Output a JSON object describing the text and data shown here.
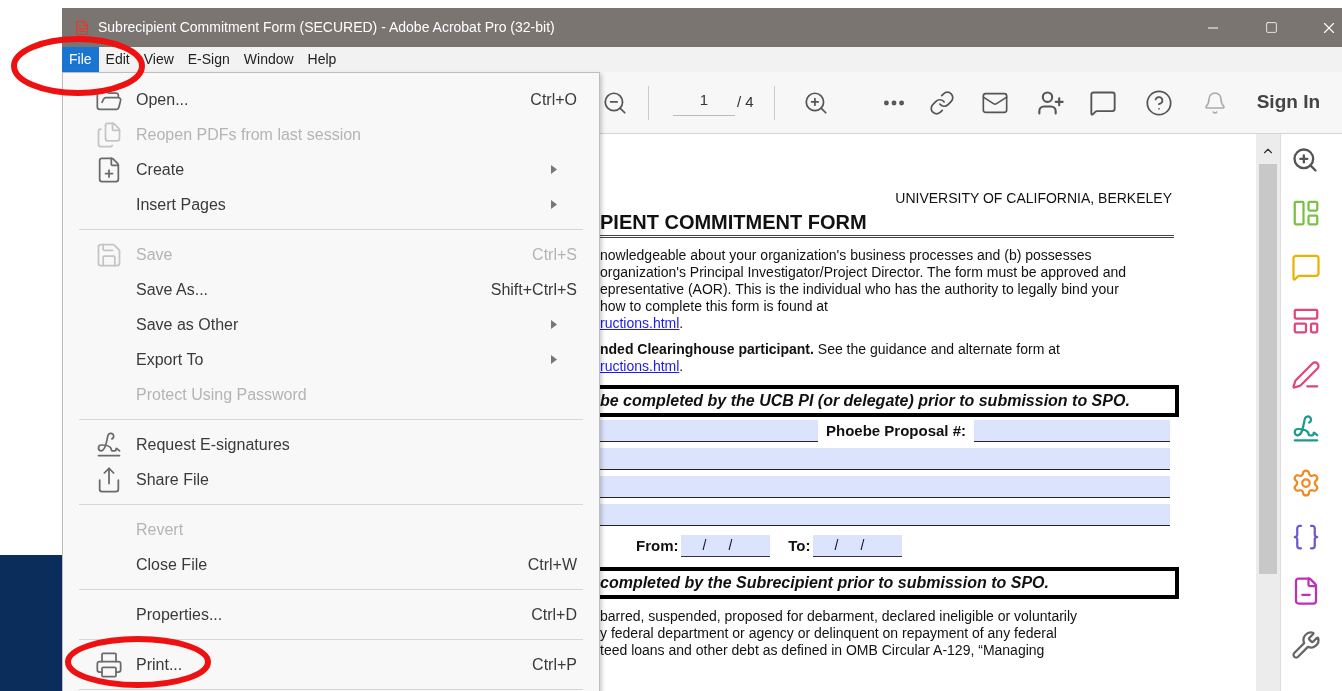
{
  "window": {
    "title": "Subrecipient Commitment Form (SECURED) - Adobe Acrobat Pro (32-bit)"
  },
  "menu_bar": [
    {
      "label": "File",
      "selected": true
    },
    {
      "label": "Edit",
      "selected": false
    },
    {
      "label": "View",
      "selected": false
    },
    {
      "label": "E-Sign",
      "selected": false
    },
    {
      "label": "Window",
      "selected": false
    },
    {
      "label": "Help",
      "selected": false
    }
  ],
  "file_menu": [
    {
      "kind": "item",
      "label": "Open...",
      "shortcut": "Ctrl+O",
      "disabled": false,
      "submenu": false
    },
    {
      "kind": "item",
      "label": "Reopen PDFs from last session",
      "disabled": true,
      "submenu": false
    },
    {
      "kind": "item",
      "label": "Create",
      "disabled": false,
      "submenu": true
    },
    {
      "kind": "item",
      "label": "Insert Pages",
      "disabled": false,
      "submenu": true
    },
    {
      "kind": "separator"
    },
    {
      "kind": "item",
      "label": "Save",
      "shortcut": "Ctrl+S",
      "disabled": true,
      "submenu": false
    },
    {
      "kind": "item",
      "label": "Save As...",
      "shortcut": "Shift+Ctrl+S",
      "disabled": false,
      "submenu": false
    },
    {
      "kind": "item",
      "label": "Save as Other",
      "disabled": false,
      "submenu": true
    },
    {
      "kind": "item",
      "label": "Export To",
      "disabled": false,
      "submenu": true
    },
    {
      "kind": "item",
      "label": "Protect Using Password",
      "disabled": true,
      "submenu": false
    },
    {
      "kind": "separator"
    },
    {
      "kind": "item",
      "label": "Request E-signatures",
      "disabled": false,
      "submenu": false
    },
    {
      "kind": "item",
      "label": "Share File",
      "disabled": false,
      "submenu": false
    },
    {
      "kind": "separator"
    },
    {
      "kind": "item",
      "label": "Revert",
      "disabled": true,
      "submenu": false
    },
    {
      "kind": "item",
      "label": "Close File",
      "shortcut": "Ctrl+W",
      "disabled": false,
      "submenu": false
    },
    {
      "kind": "separator"
    },
    {
      "kind": "item",
      "label": "Properties...",
      "shortcut": "Ctrl+D",
      "disabled": false,
      "submenu": false
    },
    {
      "kind": "separator"
    },
    {
      "kind": "item",
      "label": "Print...",
      "shortcut": "Ctrl+P",
      "disabled": false,
      "submenu": false
    },
    {
      "kind": "separator"
    }
  ],
  "toolbar": {
    "page_number": "1",
    "page_total": "/ 4",
    "sign_in": "Sign In"
  },
  "document": {
    "header": "UNIVERSITY OF CALIFORNIA, BERKELEY",
    "title": "PIENT COMMITMENT FORM",
    "blocks": [
      {
        "kind": "paragraph",
        "lines": [
          "nowledgeable about your organization's business processes and (b) possesses",
          "organization's Principal Investigator/Project Director. The form must be approved and",
          "epresentative (AOR). This is the individual who has the authority to legally bind your",
          "how to complete this form is found at"
        ],
        "link": "ructions.html",
        "after": "."
      },
      {
        "kind": "paragraph",
        "lines": [
          "**nded Clearinghouse participant.** See the guidance and alternate form at"
        ],
        "link": "ructions.html",
        "after": "."
      },
      {
        "kind": "banner",
        "text": "be completed by the UCB PI (or delegate) prior to submission to SPO."
      },
      {
        "kind": "proposal_row",
        "label": "Phoebe Proposal #:"
      },
      {
        "kind": "field_row"
      },
      {
        "kind": "field_row"
      },
      {
        "kind": "field_row"
      },
      {
        "kind": "date_row",
        "from": "From:",
        "from_slashes": [
          "/",
          "/"
        ],
        "to": "To:",
        "to_slashes": [
          "/",
          "/"
        ]
      },
      {
        "kind": "banner",
        "text": "completed by the Subrecipient prior to submission to SPO."
      },
      {
        "kind": "paragraph",
        "lines": [
          "barred, suspended, proposed for debarment, declared ineligible or voluntarily",
          "y federal department or agency or delinquent on repayment of any federal",
          "teed loans and other debt as defined in OMB Circular A-129, “Managing"
        ]
      }
    ]
  }
}
